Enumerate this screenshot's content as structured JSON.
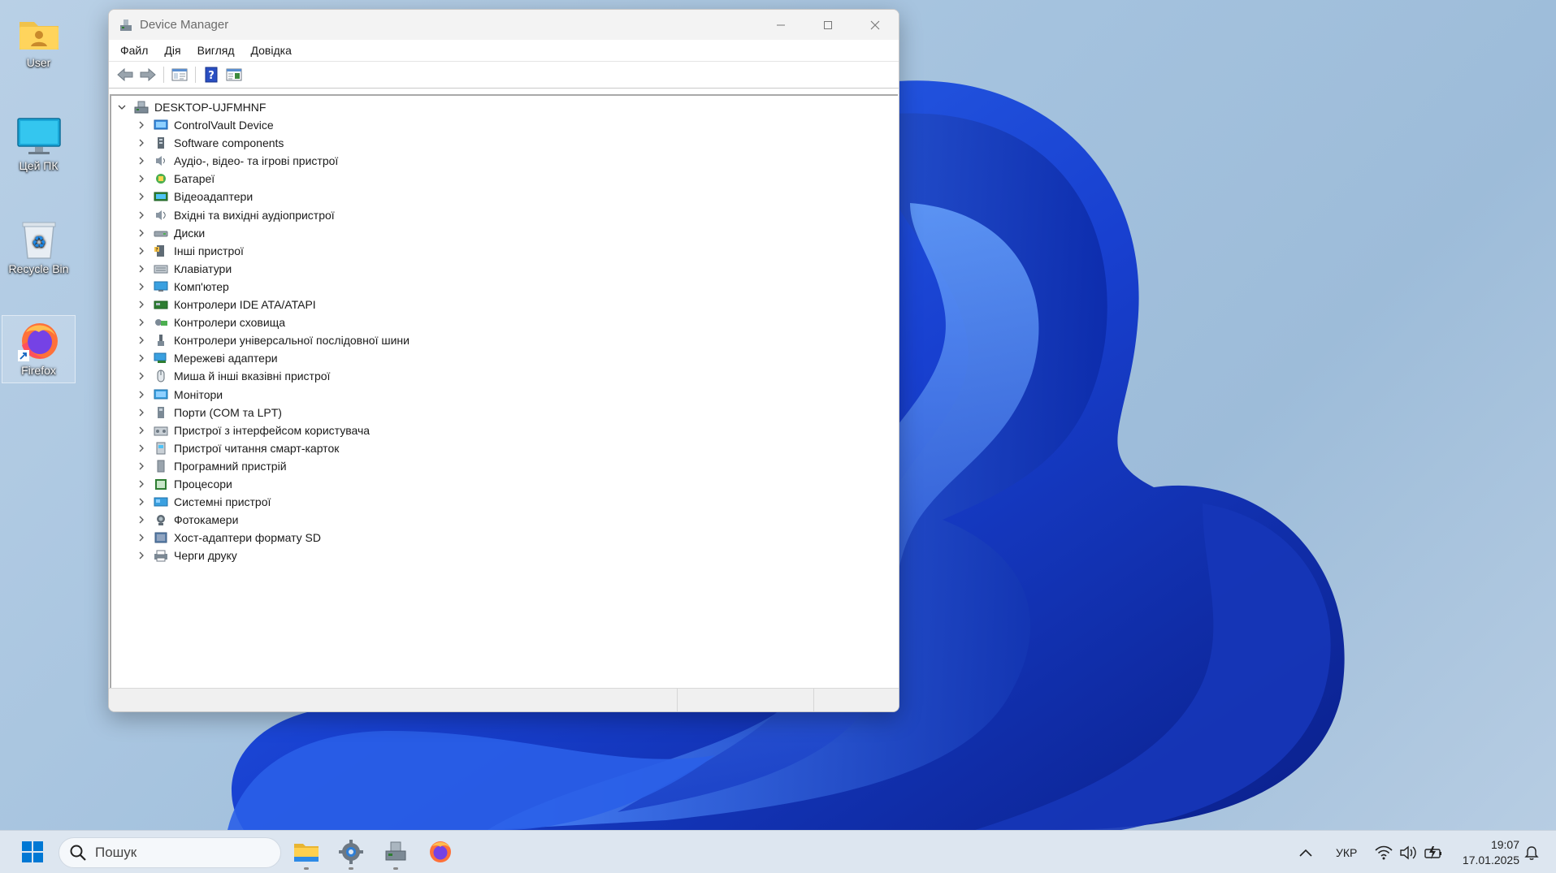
{
  "desktop": {
    "icons": [
      {
        "label": "User",
        "icon": "user-folder-icon"
      },
      {
        "label": "Цей ПК",
        "icon": "this-pc-icon"
      },
      {
        "label": "Recycle Bin",
        "icon": "recycle-bin-icon"
      },
      {
        "label": "Firefox",
        "icon": "firefox-icon"
      }
    ]
  },
  "window": {
    "title": "Device Manager",
    "menu": [
      "Файл",
      "Дія",
      "Вигляд",
      "Довідка"
    ],
    "tree": {
      "root": "DESKTOP-UJFMHNF",
      "items": [
        "ControlVault Device",
        "Software components",
        "Аудіо-, відео- та ігрові пристрої",
        "Батареї",
        "Відеоадаптери",
        "Вхідні та вихідні аудіопристрої",
        "Диски",
        "Інші пристрої",
        "Клавіатури",
        "Комп'ютер",
        "Контролери IDE ATA/ATAPI",
        "Контролери сховища",
        "Контролери універсальної послідовної шини",
        "Мережеві адаптери",
        "Миша й інші вказівні пристрої",
        "Монітори",
        "Порти (COM та LPT)",
        "Пристрої з інтерфейсом користувача",
        "Пристрої читання смарт-карток",
        "Програмний пристрій",
        "Процесори",
        "Системні пристрої",
        "Фотокамери",
        "Хост-адаптери формату SD",
        "Черги друку"
      ]
    }
  },
  "taskbar": {
    "search_placeholder": "Пошук",
    "language": "УКР",
    "time": "19:07",
    "date": "17.01.2025"
  },
  "colors": {
    "accent": "#0067c0",
    "wallpaper_blue": "#1a47d6"
  }
}
